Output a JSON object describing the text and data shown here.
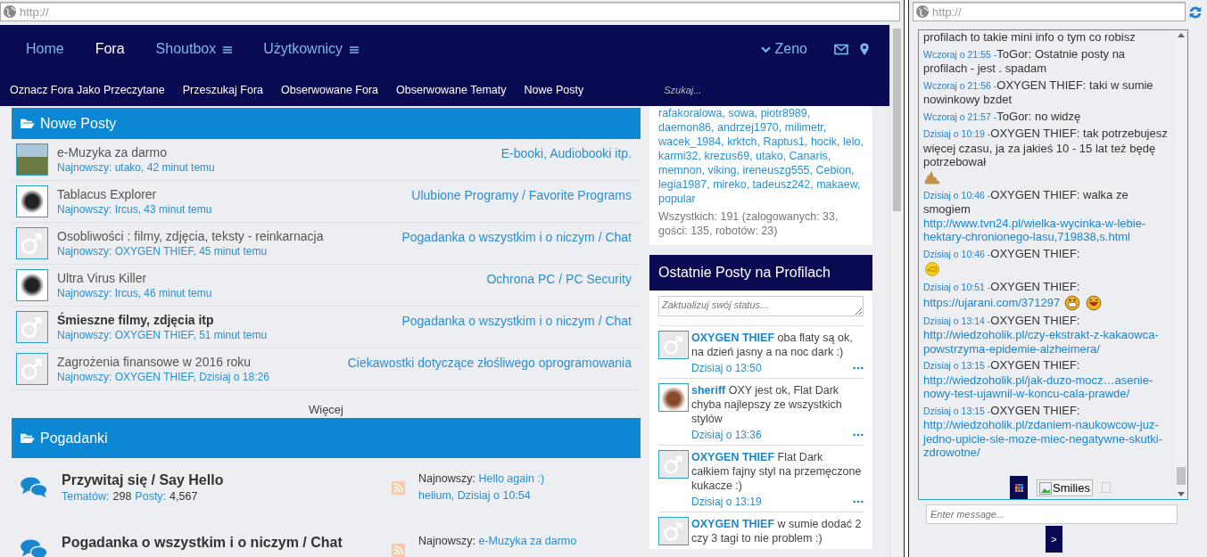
{
  "left_address_bar": {
    "value": "http://"
  },
  "nav": {
    "items": [
      {
        "label": "Home",
        "selected": false,
        "menu": false
      },
      {
        "label": "Fora",
        "selected": true,
        "menu": false
      },
      {
        "label": "Shoutbox",
        "selected": false,
        "menu": true
      },
      {
        "label": "Użytkownicy",
        "selected": false,
        "menu": true
      }
    ],
    "user": "Zeno",
    "subnav": [
      "Oznacz Fora Jako Przeczytane",
      "Przeszukaj Fora",
      "Obserwowane Fora",
      "Obserwowane Tematy",
      "Nowe Posty"
    ],
    "search": {
      "placeholder": "Szukaj..."
    }
  },
  "new_posts": {
    "title": "Nowe Posty",
    "rows": [
      {
        "kind": "photo",
        "title": "e-Muzyka za darmo",
        "bold": false,
        "latest": "Najnowszy: utako, 42 minut temu",
        "forum": "E-booki, Audiobooki itp."
      },
      {
        "kind": "picture",
        "title": "Tablacus Explorer",
        "bold": false,
        "latest": "Najnowszy: Ircus, 43 minut temu",
        "forum": "Ulubione Programy / Favorite Programs"
      },
      {
        "kind": "default",
        "title": "Osobliwości : filmy, zdjęcia, teksty - reinkarnacja",
        "bold": false,
        "latest": "Najnowszy: OXYGEN THIEF, 45 minut temu",
        "forum": "Pogadanka o wszystkim i o niczym / Chat"
      },
      {
        "kind": "picture",
        "title": "Ultra Virus Killer",
        "bold": false,
        "latest": "Najnowszy: Ircus, 46 minut temu",
        "forum": "Ochrona PC / PC Security"
      },
      {
        "kind": "default",
        "title": "Śmieszne filmy, zdjęcia itp",
        "bold": true,
        "latest": "Najnowszy: OXYGEN THIEF, 51 minut temu",
        "forum": "Pogadanka o wszystkim i o niczym / Chat"
      },
      {
        "kind": "default",
        "title": "Zagrożenia finansowe w 2016 roku",
        "bold": false,
        "latest": "Najnowszy: OXYGEN THIEF, Dzisiaj o 18:26",
        "forum": "Ciekawostki dotyczące złośliwego oprogramowania"
      }
    ],
    "more": "Więcej"
  },
  "forums": {
    "title": "Pogadanki",
    "items": [
      {
        "name": "Przywitaj się / Say Hello",
        "topics_label": "Tematów:",
        "topics": "298",
        "posts_label": "Posty:",
        "posts": "4,567",
        "latest_label": "Najnowszy:",
        "latest_title": "Hello again :)",
        "latest_meta": "helium, Dzisiaj o 10:54"
      },
      {
        "name": "Pogadanka o wszystkim i o niczym / Chat",
        "latest_label": "Najnowszy:",
        "latest_title": "e-Muzyka za darmo"
      }
    ]
  },
  "online": {
    "users": "rafakoralowa, sowa, piotr8989, daemon86, andrzej1970, milimetr, wacek_1984, krktch, Raptus1, hocik, lelo, karmi32, krezus69, utako, Canaris, memnon, viking, ireneuszg555, Cebion, legia1987, mireko, tadeusz242, makaew, popular",
    "total": "Wszystkich: 191 (zalogowanych: 33, gości: 135, robotów: 23)"
  },
  "profile_posts": {
    "title": "Ostatnie Posty na Profilach",
    "status_placeholder": "Zaktualizuj swój status...",
    "posts": [
      {
        "kind": "default",
        "author": "OXYGEN THIEF",
        "text": "oba flaty są ok, na dzień jasny a na noc dark :)",
        "time": "Dzisiaj o 13:50"
      },
      {
        "kind": "picture",
        "author": "sheriff",
        "text": "OXY jest ok, Flat Dark chyba najlepszy ze wszystkich stylów",
        "time": "Dzisiaj o 13:36"
      },
      {
        "kind": "default",
        "author": "OXYGEN THIEF",
        "text": "Flat Dark całkiem fajny styl na przemęczone kukacze :)",
        "time": "Dzisiaj o 13:19"
      },
      {
        "kind": "default",
        "author": "OXYGEN THIEF",
        "text": "w sumie dodać 2 czy 3 tagi to nie problem :)"
      }
    ]
  },
  "shoutbox": {
    "address_bar": {
      "value": "http://"
    },
    "messages": [
      {
        "text": "profilach to takie mini info o tym co robisz"
      },
      {
        "time": "Wczoraj o 21:55 -",
        "text": "ToGor: Ostatnie posty na profilach - jest . spadam"
      },
      {
        "time": "Wczoraj o 21:56 -",
        "text": "OXYGEN THIEF: taki w sumie nowinkowy bzdet"
      },
      {
        "time": "Wczoraj o 21:57 -",
        "text": "ToGor: no widzę"
      },
      {
        "time": "Dzisiaj o 10:19 -",
        "text": "OXYGEN THIEF: tak potrzebujesz więcej czasu, ja za jakieś 10 - 15 lat też będę potrzebował",
        "emoji": [
          {
            "kind": "poop"
          }
        ]
      },
      {
        "time": "Dzisiaj o 10:46 -",
        "text": "OXYGEN THIEF: walka ze smogiem",
        "link": "http://www.tvn24.pl/wielka-wycinka-w-lebie-hektary-chronionego-lasu,719838,s.html"
      },
      {
        "time": "Dzisiaj o 10:46 -",
        "text": "OXYGEN THIEF:",
        "emoji": [
          {
            "kind": "facepalm"
          }
        ]
      },
      {
        "time": "Dzisiaj o 10:51 -",
        "text": "OXYGEN THIEF:",
        "link": "https://ujarani.com/371297",
        "emoji": [
          {
            "kind": "grin"
          },
          {
            "kind": "laugh"
          }
        ]
      },
      {
        "time": "Dzisiaj o 13:14 -",
        "text": "OXYGEN THIEF:",
        "link": "http://wiedzoholik.pl/czy-ekstrakt-z-kakaowca-powstrzyma-epidemie-alzheimera/"
      },
      {
        "time": "Dzisiaj o 13:15 -",
        "text": "OXYGEN THIEF:",
        "link": "http://wiedzoholik.pl/jak-duzo-mocz…asenie-nowy-test-ujawnil-w-koncu-cala-prawde/"
      },
      {
        "time": "Dzisiaj o 13:15 -",
        "text": "OXYGEN THIEF:",
        "link": "http://wiedzoholik.pl/zdaniem-naukowcow-juz-jedno-upicie-sie-moze-miec-negatywne-skutki-zdrowotne/"
      }
    ],
    "smilies": "Smilies",
    "checked": false,
    "input_placeholder": "Enter message...",
    "send": ">"
  }
}
